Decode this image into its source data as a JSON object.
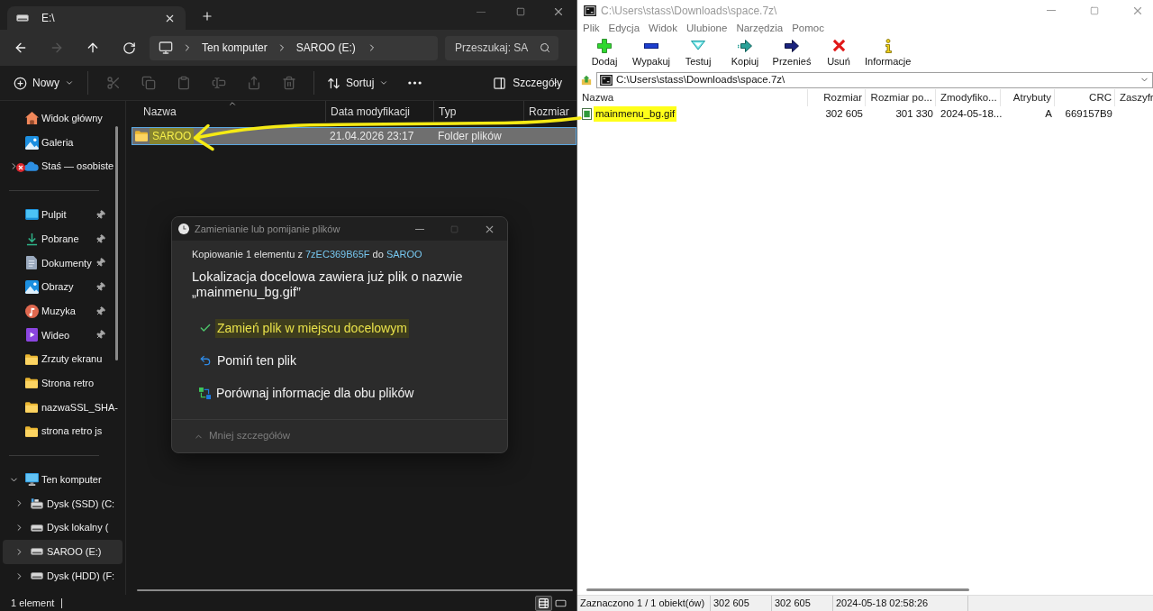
{
  "explorer": {
    "tab": {
      "title": "E:\\"
    },
    "nav_buttons": [
      {
        "kind": "back",
        "disabled": false
      },
      {
        "kind": "forward",
        "disabled": true
      },
      {
        "kind": "up",
        "disabled": false
      },
      {
        "kind": "refresh",
        "disabled": false
      }
    ],
    "breadcrumb": [
      "Ten komputer",
      "SAROO (E:)"
    ],
    "search": {
      "placeholder": "Przeszukaj: SA"
    },
    "command_bar": {
      "new_label": "Nowy",
      "actions": [
        {
          "kind": "cut",
          "disabled": true
        },
        {
          "kind": "copy",
          "disabled": true
        },
        {
          "kind": "paste",
          "disabled": true
        },
        {
          "kind": "rename",
          "disabled": true
        },
        {
          "kind": "share",
          "disabled": true
        },
        {
          "kind": "delete",
          "disabled": true
        }
      ],
      "sort_label": "Sortuj",
      "details_label": "Szczegóły"
    },
    "sidebar": {
      "top": [
        {
          "label": "Widok główny",
          "kind": "home",
          "selected": false
        },
        {
          "label": "Galeria",
          "kind": "gallery",
          "selected": false
        }
      ],
      "onedrive": {
        "label": "Staś — osobiste",
        "expanded": false,
        "sync_error": true,
        "selected": false
      },
      "quick_access": [
        {
          "label": "Pulpit",
          "kind": "desktop",
          "pinned": true,
          "selected": false
        },
        {
          "label": "Pobrane",
          "kind": "download",
          "pinned": true,
          "selected": false
        },
        {
          "label": "Dokumenty",
          "kind": "documents",
          "pinned": true,
          "selected": false
        },
        {
          "label": "Obrazy",
          "kind": "pictures",
          "pinned": true,
          "selected": false
        },
        {
          "label": "Muzyka",
          "kind": "music",
          "pinned": true,
          "selected": false
        },
        {
          "label": "Wideo",
          "kind": "video",
          "pinned": true,
          "selected": false
        },
        {
          "label": "Zrzuty ekranu",
          "kind": "folder",
          "pinned": false,
          "selected": false
        },
        {
          "label": "Strona retro",
          "kind": "folder",
          "pinned": false,
          "selected": false
        },
        {
          "label": "nazwaSSL_SHA-",
          "kind": "folder",
          "pinned": false,
          "selected": false
        },
        {
          "label": "strona retro js",
          "kind": "folder",
          "pinned": false,
          "selected": false
        }
      ],
      "this_pc": {
        "label": "Ten komputer",
        "expanded": true,
        "selected": false,
        "children": [
          {
            "label": "Dysk (SSD) (C:",
            "kind": "ssd",
            "expanded": false,
            "selected": false
          },
          {
            "label": "Dysk lokalny (",
            "kind": "drive",
            "expanded": false,
            "selected": false
          },
          {
            "label": "SAROO (E:)",
            "kind": "drive",
            "expanded": false,
            "selected": true
          },
          {
            "label": "Dysk (HDD) (F:",
            "kind": "drive",
            "expanded": false,
            "selected": false
          }
        ]
      }
    },
    "files": {
      "columns": [
        {
          "label": "Nazwa",
          "sorted": true
        },
        {
          "label": "Data modyfikacji",
          "sorted": false
        },
        {
          "label": "Typ",
          "sorted": false
        },
        {
          "label": "Rozmiar",
          "sorted": false
        }
      ],
      "rows": [
        {
          "name": "SAROO",
          "modified": "21.04.2026 23:17",
          "type": "Folder plików",
          "selected": true,
          "highlighted": true
        }
      ]
    },
    "status": {
      "count": "1 element",
      "views": [
        {
          "kind": "details",
          "selected": true
        },
        {
          "kind": "tiles",
          "selected": false
        }
      ]
    }
  },
  "dialog": {
    "title": "Zamienianie lub pomijanie plików",
    "title_buttons": [
      {
        "kind": "minimize",
        "disabled": false
      },
      {
        "kind": "maximize",
        "disabled": true
      },
      {
        "kind": "close",
        "disabled": false
      }
    ],
    "summary": {
      "before": "Kopiowanie 1 elementu z",
      "source": "7zEC369B65F",
      "between": "do",
      "destination": "SAROO"
    },
    "message": "Lokalizacja docelowa zawiera już plik o nazwie „mainmenu_bg.gif”",
    "options": [
      {
        "kind": "replace",
        "label": "Zamień plik w miejscu docelowym",
        "highlighted": true
      },
      {
        "kind": "skip",
        "label": "Pomiń ten plik",
        "highlighted": false
      },
      {
        "kind": "compare",
        "label": "Porównaj informacje dla obu plików",
        "highlighted": false
      }
    ],
    "details_toggle": {
      "label": "Mniej szczegółów",
      "expanded": true
    }
  },
  "sevenzip": {
    "title": "C:\\Users\\stass\\Downloads\\space.7z\\",
    "menu": [
      "Plik",
      "Edycja",
      "Widok",
      "Ulubione",
      "Narzędzia",
      "Pomoc"
    ],
    "toolbar": [
      {
        "kind": "add",
        "label": "Dodaj"
      },
      {
        "kind": "extract",
        "label": "Wypakuj"
      },
      {
        "kind": "test",
        "label": "Testuj"
      },
      {
        "kind": "copy",
        "label": "Kopiuj"
      },
      {
        "kind": "move",
        "label": "Przenieś"
      },
      {
        "kind": "delete",
        "label": "Usuń"
      },
      {
        "kind": "info",
        "label": "Informacje"
      }
    ],
    "path": "C:\\Users\\stass\\Downloads\\space.7z\\",
    "columns": [
      "Nazwa",
      "Rozmiar",
      "Rozmiar po...",
      "Zmodyfiko...",
      "Atrybuty",
      "CRC",
      "Zaszyfr"
    ],
    "rows": [
      {
        "cells": [
          "mainmenu_bg.gif",
          "302 605",
          "301 330",
          "2024-05-18...",
          "A",
          "669157B9"
        ],
        "highlighted": true
      }
    ],
    "status": [
      "Zaznaczono 1 / 1 obiekt(ów)",
      "302 605",
      "302 605",
      "2024-05-18 02:58:26"
    ]
  }
}
